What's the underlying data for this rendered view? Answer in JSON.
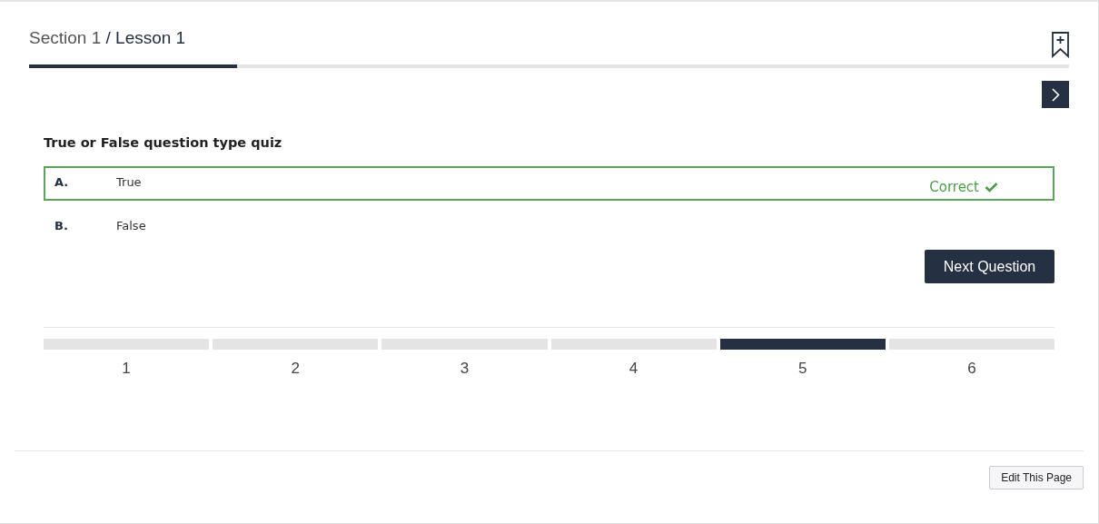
{
  "breadcrumb": {
    "section": "Section 1",
    "lesson": "/ Lesson 1"
  },
  "lesson_progress": {
    "level": 0.2
  },
  "question": {
    "title": "True or False question type quiz",
    "options": [
      {
        "letter": "A.",
        "text": "True",
        "correct": true,
        "result_label": "Correct"
      },
      {
        "letter": "B.",
        "text": "False",
        "correct": false
      }
    ],
    "next_button": "Next Question"
  },
  "steps": [
    {
      "label": "1",
      "selected": false
    },
    {
      "label": "2",
      "selected": false
    },
    {
      "label": "3",
      "selected": false
    },
    {
      "label": "4",
      "selected": false
    },
    {
      "label": "5",
      "selected": true
    },
    {
      "label": "6",
      "selected": false
    }
  ],
  "footer": {
    "edit_button": "Edit This Page"
  }
}
